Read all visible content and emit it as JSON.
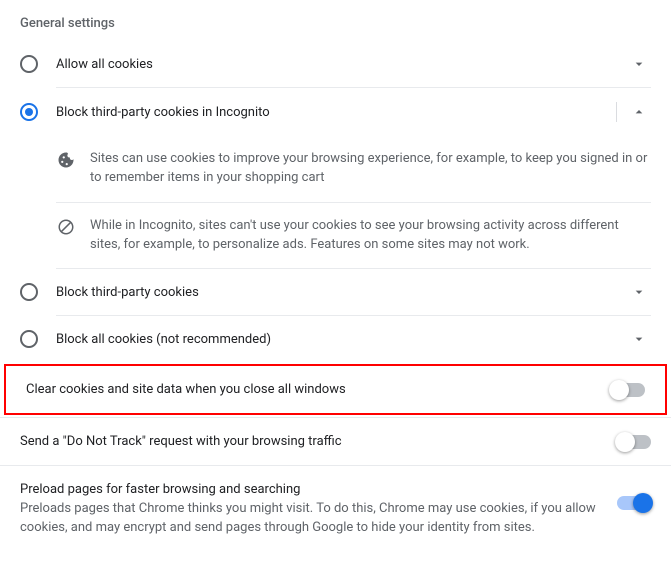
{
  "section_title": "General settings",
  "options": {
    "allow_all": "Allow all cookies",
    "block_incognito": "Block third-party cookies in Incognito",
    "block_third": "Block third-party cookies",
    "block_all": "Block all cookies (not recommended)"
  },
  "details": {
    "cookie_info": "Sites can use cookies to improve your browsing experience, for example, to keep you signed in or to remember items in your shopping cart",
    "incognito_info": "While in Incognito, sites can't use your cookies to see your browsing activity across different sites, for example, to personalize ads. Features on some sites may not work."
  },
  "toggles": {
    "clear_on_close": "Clear cookies and site data when you close all windows",
    "do_not_track": "Send a \"Do Not Track\" request with your browsing traffic"
  },
  "preload": {
    "title": "Preload pages for faster browsing and searching",
    "desc": "Preloads pages that Chrome thinks you might visit. To do this, Chrome may use cookies, if you allow cookies, and may encrypt and send pages through Google to hide your identity from sites."
  }
}
